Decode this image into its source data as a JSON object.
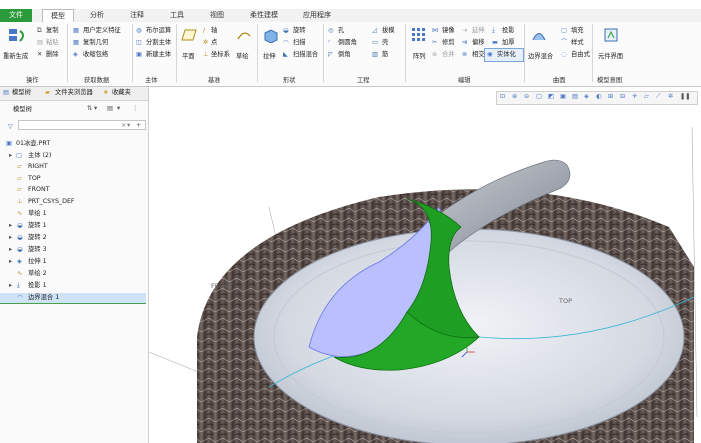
{
  "menu": {
    "file": "文件",
    "model": "模型",
    "analysis": "分析",
    "annotate": "注释",
    "tools": "工具",
    "view": "视图",
    "flexible": "柔性建模",
    "apps": "应用程序"
  },
  "ribbon": {
    "regen": "重新生成",
    "copy": "复制",
    "paste": "粘贴",
    "delete": "删除",
    "udf": "用户定义特征",
    "copy_geom": "复制几何",
    "shrinkwrap": "收缩包络",
    "boolean": "布尔运算",
    "split_body": "分割主体",
    "new_body": "新建主体",
    "plane": "平面",
    "axis": "轴",
    "point": "点",
    "csys": "坐标系",
    "sketch": "草绘",
    "extrude": "拉伸",
    "revolve": "旋转",
    "sweep": "扫描",
    "swept_blend": "扫描混合",
    "hole": "孔",
    "round": "倒圆角",
    "chamfer": "倒角",
    "draft": "拔模",
    "shell": "壳",
    "rib": "筋",
    "pattern": "阵列",
    "mirror": "镜像",
    "trim": "修剪",
    "merge": "合并",
    "extend": "延伸",
    "offset": "偏移",
    "intersect": "相交",
    "project": "投影",
    "thicken": "加厚",
    "solidify": "实体化",
    "boundary_blend": "边界混合",
    "fill": "填充",
    "style": "样式",
    "freestyle": "自由式",
    "component_interface": "元件界面",
    "group_operations": "操作",
    "group_get_data": "获取数据",
    "group_body": "主体",
    "group_datum": "基准",
    "group_shapes": "形状",
    "group_engineering": "工程",
    "group_editing": "编辑",
    "group_surfaces": "曲面",
    "group_model_intent": "模型意图"
  },
  "left_tabs": {
    "model_tree": "模型树",
    "folder_browser": "文件夹浏览器",
    "favorites": "收藏夹"
  },
  "tree": {
    "header": "模型树",
    "search_placeholder": "",
    "items": [
      {
        "label": "01冰壶.PRT"
      },
      {
        "label": "主体 (2)"
      },
      {
        "label": "RIGHT"
      },
      {
        "label": "TOP"
      },
      {
        "label": "FRONT"
      },
      {
        "label": "PRT_CSYS_DEF"
      },
      {
        "label": "草绘 1"
      },
      {
        "label": "旋转 1"
      },
      {
        "label": "旋转 2"
      },
      {
        "label": "旋转 3"
      },
      {
        "label": "拉伸 1"
      },
      {
        "label": "草绘 2"
      },
      {
        "label": "投影 1"
      },
      {
        "label": "边界混合 1"
      }
    ]
  },
  "viewport": {
    "label_top": "TOP",
    "label_front": "FRONT"
  },
  "colors": {
    "accent": "#2a9a3a",
    "handle_green": "#1f9e24",
    "selection_blue": "#b9bfff"
  }
}
